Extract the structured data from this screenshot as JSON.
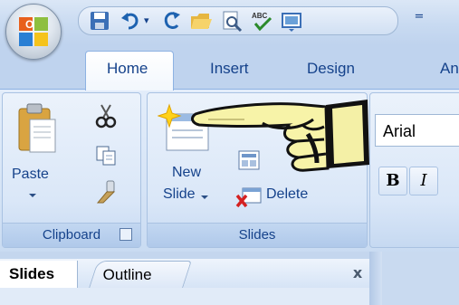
{
  "tabs": [
    {
      "label": "Home"
    },
    {
      "label": "Insert"
    },
    {
      "label": "Design"
    },
    {
      "label": "An"
    }
  ],
  "quick_access_toolbar": {
    "buttons": [
      "save-icon",
      "undo-icon",
      "redo-icon",
      "open-folder-icon",
      "print-preview-icon",
      "spelling-icon",
      "slide-show-icon"
    ],
    "more": "="
  },
  "ribbon": {
    "clipboard": {
      "paste_label": "Paste",
      "group_label": "Clipboard",
      "dialog_launcher_icon": "dialog-launcher-icon"
    },
    "slides": {
      "new_slide_line1": "New",
      "new_slide_line2": "Slide",
      "delete_label": "Delete",
      "group_label": "Slides"
    },
    "font": {
      "font_name": "Arial",
      "bold_label": "B",
      "italic_label": "I"
    }
  },
  "side_panel": {
    "tabs": [
      {
        "label": "Slides"
      },
      {
        "label": "Outline"
      }
    ],
    "close_label": "x"
  },
  "colors": {
    "tab_text": "#15428b",
    "ribbon_bg": "#d6e4f6",
    "title_bg": "#c8daf1"
  }
}
